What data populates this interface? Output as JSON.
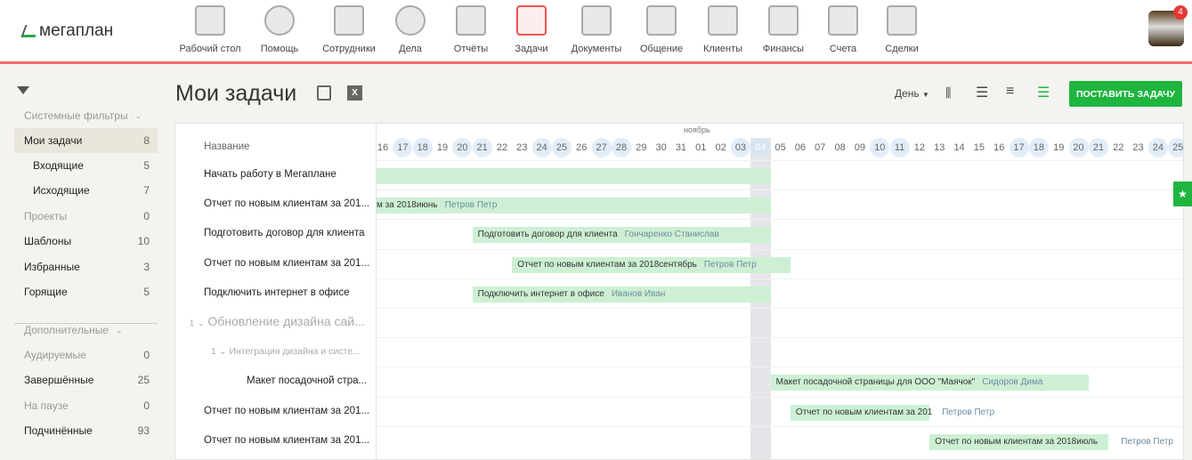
{
  "logo": "мегаплан",
  "nav": [
    {
      "label": "Рабочий стол",
      "icon": "desktop-icon"
    },
    {
      "label": "Помощь",
      "icon": "lifebuoy-icon"
    },
    {
      "label": "Сотрудники",
      "icon": "employees-icon"
    },
    {
      "label": "Дела",
      "icon": "clock-icon"
    },
    {
      "label": "Отчёты",
      "icon": "reports-icon"
    },
    {
      "label": "Задачи",
      "icon": "tasks-icon",
      "active": true
    },
    {
      "label": "Документы",
      "icon": "folder-icon"
    },
    {
      "label": "Общение",
      "icon": "chat-icon"
    },
    {
      "label": "Клиенты",
      "icon": "contacts-icon"
    },
    {
      "label": "Финансы",
      "icon": "safe-icon"
    },
    {
      "label": "Счета",
      "icon": "invoice-icon"
    },
    {
      "label": "Сделки",
      "icon": "briefcase-icon"
    }
  ],
  "notifications": "4",
  "sidebar": [
    {
      "label": "Системные фильтры",
      "type": "section"
    },
    {
      "label": "Мои задачи",
      "count": "8",
      "selected": true
    },
    {
      "label": "Входящие",
      "count": "5",
      "sub": true
    },
    {
      "label": "Исходящие",
      "count": "7",
      "sub": true
    },
    {
      "label": "Проекты",
      "count": "0",
      "grey": true
    },
    {
      "label": "Шаблоны",
      "count": "10"
    },
    {
      "label": "Избранные",
      "count": "3"
    },
    {
      "label": "Горящие",
      "count": "5"
    },
    {
      "label": "Дополнительные",
      "type": "section"
    },
    {
      "label": "Аудируемые",
      "count": "0",
      "grey": true
    },
    {
      "label": "Завершённые",
      "count": "25"
    },
    {
      "label": "На паузе",
      "count": "0",
      "grey": true
    },
    {
      "label": "Подчинённые",
      "count": "93"
    }
  ],
  "page_title": "Мои задачи",
  "toolbar": {
    "scale": "День",
    "add_task": "ПОСТАВИТЬ ЗАДАЧУ"
  },
  "gantt": {
    "name_header": "Название",
    "month": "ноябрь",
    "today": "04",
    "days": [
      "16",
      "17",
      "18",
      "19",
      "20",
      "21",
      "22",
      "23",
      "24",
      "25",
      "26",
      "27",
      "28",
      "29",
      "30",
      "31",
      "01",
      "02",
      "03",
      "04",
      "05",
      "06",
      "07",
      "08",
      "09",
      "10",
      "11",
      "12",
      "13",
      "14",
      "15",
      "16",
      "17",
      "18",
      "19",
      "20",
      "21",
      "22",
      "23",
      "24",
      "25"
    ],
    "weekends": [
      "20",
      "21",
      "27",
      "28",
      "03",
      "04",
      "10",
      "11",
      "17",
      "18",
      "24",
      "25"
    ],
    "rows": [
      {
        "name": "Начать работу в Мегаплане",
        "bar": {
          "start": "2018-10-01",
          "end": "2018-11-04",
          "text": "",
          "who": ""
        }
      },
      {
        "name": "Отчет по новым клиентам за 201...",
        "bar": {
          "start": "2018-10-01",
          "end": "2018-11-04",
          "text": "м за 2018июнь",
          "who": "Петров Петр"
        }
      },
      {
        "name": "Подготовить договор для клиента",
        "bar": {
          "start": "2018-10-21",
          "end": "2018-11-04",
          "text": "Подготовить договор для клиента",
          "who": "Гончаренко Станислав"
        }
      },
      {
        "name": "Отчет по новым клиентам за 201...",
        "bar": {
          "start": "2018-10-23",
          "end": "2018-11-05",
          "text": "Отчет по новым клиентам за 2018сентябрь",
          "who": "Петров Петр"
        }
      },
      {
        "name": "Подключить интернет в офисе",
        "bar": {
          "start": "2018-10-21",
          "end": "2018-11-04",
          "text": "Подключить интернет в офисе",
          "who": "Иванов Иван"
        }
      },
      {
        "name": "Обновление дизайна сай...",
        "level": 0,
        "num": "1",
        "group": true
      },
      {
        "name": "Интеграция дизайна и систе...",
        "level": 1,
        "num": "1",
        "group": true
      },
      {
        "name": "Макет посадочной стра...",
        "level": 2,
        "bar": {
          "start": "2018-11-05",
          "end": "2018-11-20",
          "text": "Макет посадочной страницы для ООО \"Маячок\"",
          "who": "Сидоров Дима"
        }
      },
      {
        "name": "Отчет по новым клиентам за 201...",
        "bar": {
          "start": "2018-11-06",
          "end": "2018-11-12",
          "text": "Отчет по новым клиентам за 201",
          "who": "Петров Петр",
          "who_outside": true
        }
      },
      {
        "name": "Отчет по новым клиентам за 201...",
        "bar": {
          "start": "2018-11-13",
          "end": "2018-11-21",
          "text": "Отчет по новым клиентам за 2018июль",
          "who": "Петров Петр",
          "who_outside": true
        }
      }
    ]
  }
}
